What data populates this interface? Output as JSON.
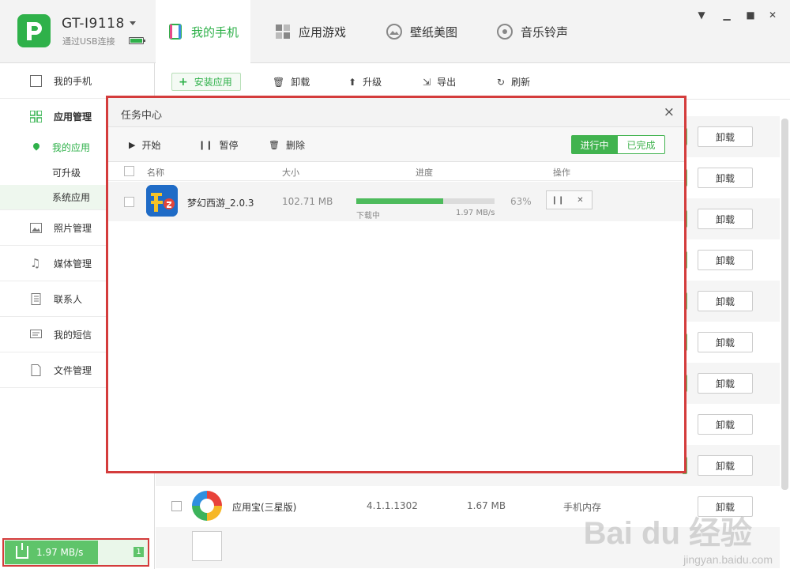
{
  "header": {
    "device_name": "GT-I9118",
    "connection": "通过USB连接",
    "tabs": [
      {
        "label": "我的手机",
        "icon": "phone-icon",
        "active": true
      },
      {
        "label": "应用游戏",
        "icon": "apps-grid-icon",
        "active": false
      },
      {
        "label": "壁纸美图",
        "icon": "wallpaper-icon",
        "active": false
      },
      {
        "label": "音乐铃声",
        "icon": "music-icon",
        "active": false
      }
    ],
    "window_controls": [
      "menu-icon",
      "minimize-icon",
      "maximize-icon",
      "close-icon"
    ]
  },
  "sidebar": {
    "items": [
      {
        "label": "我的手机",
        "icon": "phone-outline-icon"
      },
      {
        "label": "应用管理",
        "icon": "apps-grid-icon"
      },
      {
        "label": "照片管理",
        "icon": "photo-icon"
      },
      {
        "label": "媒体管理",
        "icon": "music-note-icon"
      },
      {
        "label": "联系人",
        "icon": "contacts-icon"
      },
      {
        "label": "我的短信",
        "icon": "message-icon"
      },
      {
        "label": "文件管理",
        "icon": "file-icon"
      }
    ],
    "sub_items": [
      {
        "label": "我的应用"
      },
      {
        "label": "可升级"
      },
      {
        "label": "系统应用"
      }
    ],
    "download_speed": "1.97 MB/s",
    "download_count": "1"
  },
  "toolbar": {
    "install": "安装应用",
    "uninstall": "卸载",
    "upgrade": "升级",
    "export": "导出",
    "refresh": "刷新"
  },
  "app_list": {
    "uninstall_label": "卸载",
    "visible_row": {
      "name": "应用宝(三星版)",
      "version": "4.1.1.1302",
      "size": "1.67 MB",
      "location": "手机内存",
      "action": "卸载"
    }
  },
  "dialog": {
    "title": "任务中心",
    "tools": {
      "start": "开始",
      "pause": "暂停",
      "delete": "删除"
    },
    "segment": {
      "active": "进行中",
      "inactive": "已完成"
    },
    "columns": {
      "name": "名称",
      "size": "大小",
      "progress": "进度",
      "ops": "操作"
    },
    "task": {
      "name": "梦幻西游_2.0.3",
      "size": "102.71 MB",
      "progress_percent": 63,
      "progress_label": "63%",
      "state": "下载中",
      "speed": "1.97 MB/s"
    },
    "close_label": "×"
  },
  "watermark": {
    "main": "Bai du 经验",
    "sub": "jingyan.baidu.com"
  },
  "colors": {
    "brand": "#2fb14a",
    "highlight": "#d43c3c"
  }
}
